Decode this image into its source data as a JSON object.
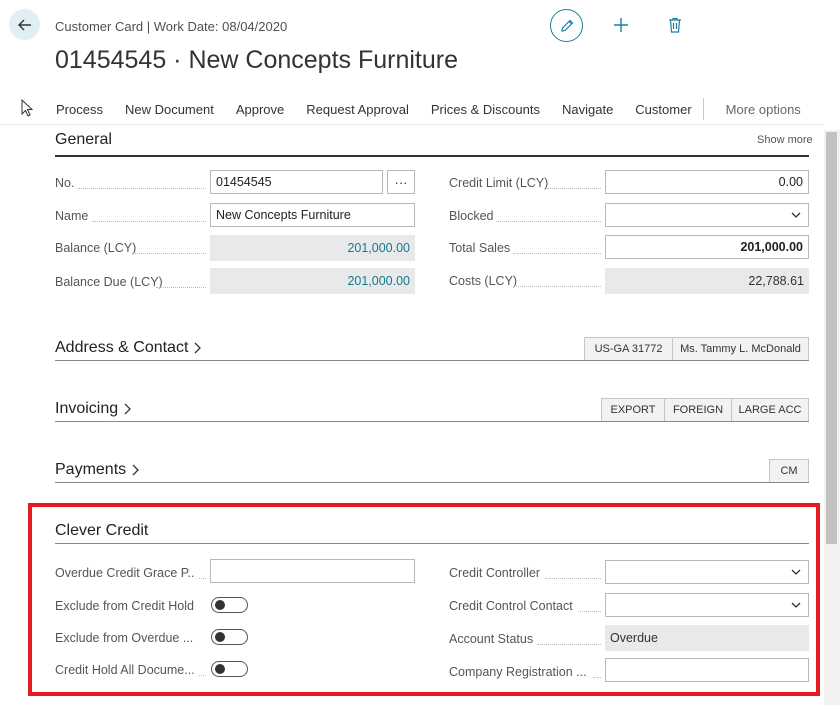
{
  "header": {
    "subtitle": "Customer Card | Work Date: 08/04/2020",
    "title": "01454545 · New Concepts Furniture"
  },
  "actions": [
    "Process",
    "New Document",
    "Approve",
    "Request Approval",
    "Prices & Discounts",
    "Navigate",
    "Customer"
  ],
  "more_options": "More options",
  "general": {
    "title": "General",
    "show_more": "Show more",
    "no_label": "No.",
    "no_value": "01454545",
    "ellipsis": "···",
    "name_label": "Name",
    "name_value": "New Concepts Furniture",
    "balance_label": "Balance (LCY)",
    "balance_value": "201,000.00",
    "balance_due_label": "Balance Due (LCY)",
    "balance_due_value": "201,000.00",
    "credit_limit_label": "Credit Limit (LCY)",
    "credit_limit_value": "0.00",
    "blocked_label": "Blocked",
    "blocked_value": "",
    "total_sales_label": "Total Sales",
    "total_sales_value": "201,000.00",
    "costs_label": "Costs (LCY)",
    "costs_value": "22,788.61"
  },
  "address": {
    "title": "Address & Contact",
    "tags": [
      "US-GA 31772",
      "Ms. Tammy L. McDonald"
    ]
  },
  "invoicing": {
    "title": "Invoicing",
    "tags": [
      "EXPORT",
      "FOREIGN",
      "LARGE ACC"
    ]
  },
  "payments": {
    "title": "Payments",
    "tags": [
      "CM"
    ]
  },
  "clever_credit": {
    "title": "Clever Credit",
    "grace_label": "Overdue Credit Grace P...",
    "grace_value": "",
    "exclude_hold_label": "Exclude from Credit Hold",
    "exclude_hold_on": false,
    "exclude_overdue_label": "Exclude from Overdue ...",
    "exclude_overdue_on": false,
    "hold_all_label": "Credit Hold All Docume...",
    "hold_all_on": false,
    "controller_label": "Credit Controller",
    "controller_value": "",
    "contact_label": "Credit Control Contact",
    "contact_value": "",
    "status_label": "Account Status",
    "status_value": "Overdue",
    "reg_label": "Company Registration ...",
    "reg_value": ""
  },
  "colors": {
    "accent": "#1b7ea0",
    "highlight_border": "#e01b22",
    "readonly_bg": "#e8e9ea",
    "teal_value": "#137b8a"
  },
  "icons": {
    "back": "back-arrow-icon",
    "edit": "pencil-icon",
    "new": "plus-icon",
    "delete": "trash-icon",
    "chevron": "chevron-right-icon",
    "dropdown": "chevron-down-icon"
  }
}
